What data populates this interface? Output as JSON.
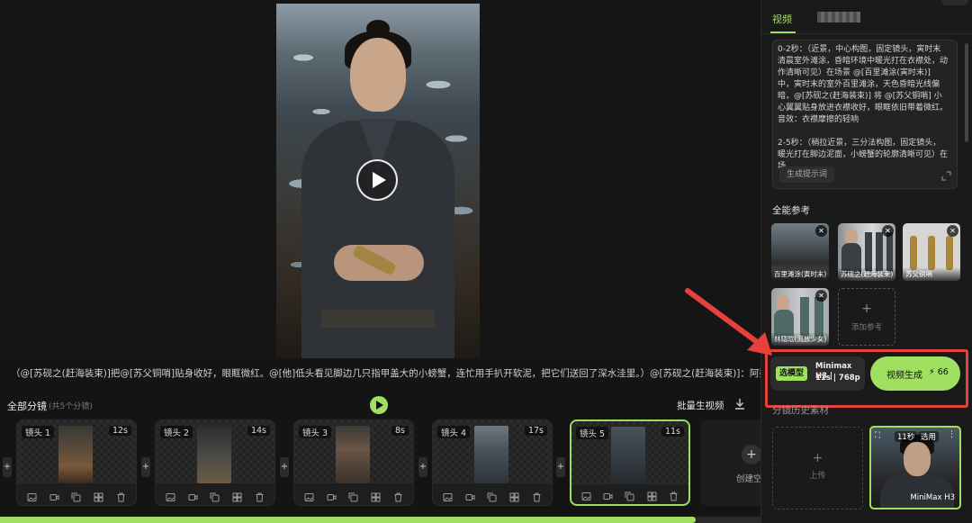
{
  "script_text": "（@[苏砚之(赶海装束)]把@[苏父铜哨]贴身收好，眼眶微红。@[他]低头看见脚边几只指甲盖大的小螃蟹，连忙用手扒开软泥，把它们送回了深水洼里。）@[苏砚之(赶海装束)]：阿婆说的，取之有度。这些...",
  "shots": {
    "title": "全部分镜",
    "count": "(共5个分镜)",
    "batch_label": "批量生视频",
    "create_label": "创建空",
    "items": [
      {
        "label": "镜头 1",
        "duration": "12s",
        "selected": false
      },
      {
        "label": "镜头 2",
        "duration": "14s",
        "selected": false
      },
      {
        "label": "镜头 3",
        "duration": "8s",
        "selected": false
      },
      {
        "label": "镜头 4",
        "duration": "17s",
        "selected": false
      },
      {
        "label": "镜头 5",
        "duration": "11s",
        "selected": true
      }
    ]
  },
  "progress": 0.915,
  "panel": {
    "tab_video": "视频",
    "prompt_text": "0-2秒：（近景，中心构图，固定镜头，寅时末清晨室外滩涂，昏暗环境中暖光打在衣襟处，动作清晰可见）在场景 @[百里滩涂(寅时末)] 中，寅时末的室外百里滩涂，天色昏暗光线偏暗，@[苏砚之(赶海装束)] 将 @[苏父铜哨] 小心翼翼贴身放进衣襟收好，眼眶依旧带着微红。\n音效：衣襟摩擦的轻响\n\n2-5秒：（稍拉近景，三分法构图，固定镜头，暖光打在脚边泥面，小螃蟹的轮廓清晰可见）在场",
    "gen_prompt_label": "生成提示词",
    "ref_title": "全能参考",
    "refs": [
      {
        "label": "百里滩涂(寅时末)"
      },
      {
        "label": "苏砚之(赶海装束)"
      },
      {
        "label": "苏父铜哨"
      },
      {
        "label": "林晓晗(流放少女)"
      }
    ],
    "add_ref_label": "添加参考",
    "model": {
      "tag": "选模型",
      "name": "Minimax H3 |",
      "spec": "11s | 768p"
    },
    "generate": {
      "label": "视频生成",
      "cost": "⚡ 66"
    },
    "history_title": "分镜历史素材",
    "upload_label": "上传",
    "history_card": {
      "duration": "11秒",
      "tag": "选用",
      "model": "MiniMax H3"
    }
  }
}
